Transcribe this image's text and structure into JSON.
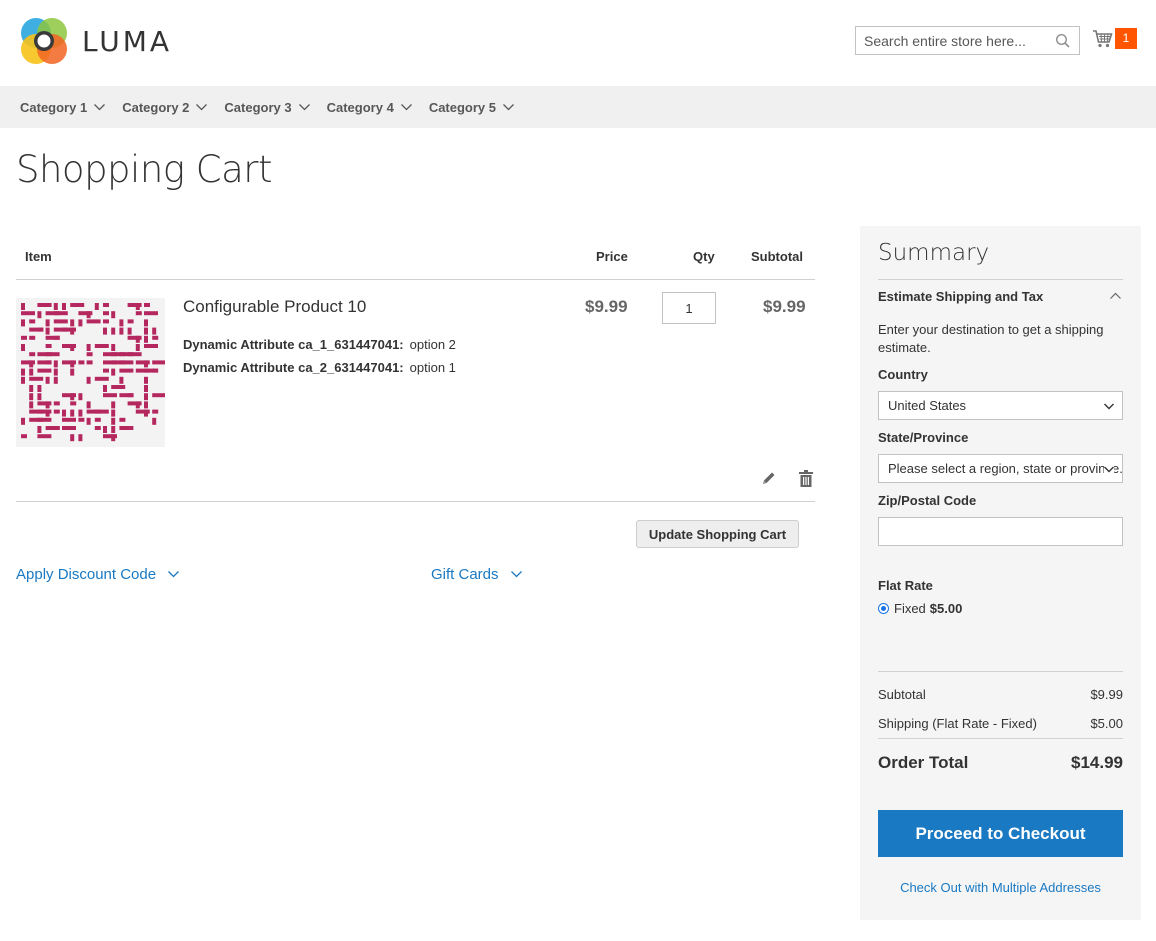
{
  "header": {
    "brand": "LUMA",
    "search_placeholder": "Search entire store here...",
    "cart_count": "1"
  },
  "nav": {
    "items": [
      "Category 1",
      "Category 2",
      "Category 3",
      "Category 4",
      "Category 5"
    ]
  },
  "page": {
    "title": "Shopping Cart"
  },
  "cart": {
    "columns": {
      "item": "Item",
      "price": "Price",
      "qty": "Qty",
      "subtotal": "Subtotal"
    },
    "items": [
      {
        "name": "Configurable Product 10",
        "attributes": [
          {
            "label": "Dynamic Attribute ca_1_631447041:",
            "value": "option 2"
          },
          {
            "label": "Dynamic Attribute ca_2_631447041:",
            "value": "option 1"
          }
        ],
        "price": "$9.99",
        "qty": "1",
        "subtotal": "$9.99"
      }
    ],
    "update_button": "Update Shopping Cart",
    "discount_label": "Apply Discount Code",
    "gift_cards_label": "Gift Cards"
  },
  "summary": {
    "title": "Summary",
    "estimate_heading": "Estimate Shipping and Tax",
    "estimate_desc": "Enter your destination to get a shipping estimate.",
    "country_label": "Country",
    "country_value": "United States",
    "state_label": "State/Province",
    "state_value": "Please select a region, state or province.",
    "zip_label": "Zip/Postal Code",
    "zip_value": "",
    "flat_rate_label": "Flat Rate",
    "flat_rate_option": "Fixed",
    "flat_rate_price": "$5.00",
    "subtotal_label": "Subtotal",
    "subtotal_value": "$9.99",
    "shipping_label": "Shipping (Flat Rate - Fixed)",
    "shipping_value": "$5.00",
    "order_total_label": "Order Total",
    "order_total_value": "$14.99",
    "checkout_button": "Proceed to Checkout",
    "multi_address_link": "Check Out with Multiple Addresses"
  },
  "colors": {
    "accent_blue": "#1979c3",
    "cart_badge": "#ff5501",
    "nav_bg": "#f0f0f0",
    "summary_bg": "#f5f5f5",
    "thumb_pattern": "#b5285f"
  }
}
